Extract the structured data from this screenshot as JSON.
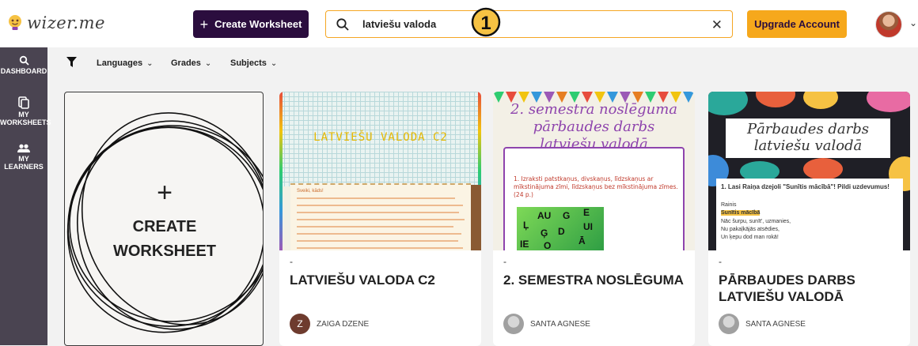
{
  "header": {
    "logo_text": "wizer.me",
    "create_button": "Create Worksheet",
    "search_value": "latviešu valoda",
    "step_badge": "1",
    "upgrade_button": "Upgrade Account"
  },
  "sidebar": {
    "items": [
      {
        "label": "DASHBOARD",
        "icon": "search-icon"
      },
      {
        "label": "MY WORKSHEETS",
        "icon": "worksheets-icon"
      },
      {
        "label": "MY LEARNERS",
        "icon": "learners-icon"
      }
    ]
  },
  "filters": {
    "items": [
      {
        "label": "Languages"
      },
      {
        "label": "Grades"
      },
      {
        "label": "Subjects"
      }
    ]
  },
  "create_card": {
    "plus": "+",
    "line1": "CREATE",
    "line2": "WORKSHEET"
  },
  "cards": [
    {
      "dash": "-",
      "title": "LATVIEŠU VALODA C2",
      "author": "ZAIGA DZENE",
      "avatar_letter": "Z",
      "avatar_color": "#6e3b2e",
      "thumb_heading": "LATVIEŠU VALODA C2",
      "thumb_text": "Sveiki, kāds!"
    },
    {
      "dash": "-",
      "title": "2. SEMESTRA NOSLĒGUMA",
      "author": "SANTA AGNESE",
      "thumb_heading_1": "2. semestra noslēguma",
      "thumb_heading_2": "pārbaudes darbs",
      "thumb_heading_3": "latviešu valodā",
      "thumb_task": "1. Izraksti patstkaņus, divskaņus, līdzskaņus ar mīkstinājuma zīmi, līdzskaņus bez mīkstinājuma zīmes. (24 p.)",
      "thumb_tiles": [
        "AU",
        "G",
        "A",
        "E",
        "Ļ",
        "Ģ",
        "D",
        "UI",
        "Ā",
        "U",
        "IE",
        "O"
      ]
    },
    {
      "dash": "-",
      "title": "PĀRBAUDES DARBS LATVIEŠU VALODĀ",
      "author": "SANTA AGNESE",
      "thumb_heading_1": "Pārbaudes darbs",
      "thumb_heading_2": "latviešu valodā",
      "thumb_task": "1. Lasi Raiņa dzejoli \"Sunītis mācībā\"! Pildi uzdevumus!",
      "thumb_lines": [
        "Rainis",
        "Sunītis mācībā",
        "Nāc šurpu, sunīt', uzmanies,",
        "Nu pakaļkājās atsēdies,",
        "Un ķepu dod man rokā!"
      ]
    }
  ]
}
